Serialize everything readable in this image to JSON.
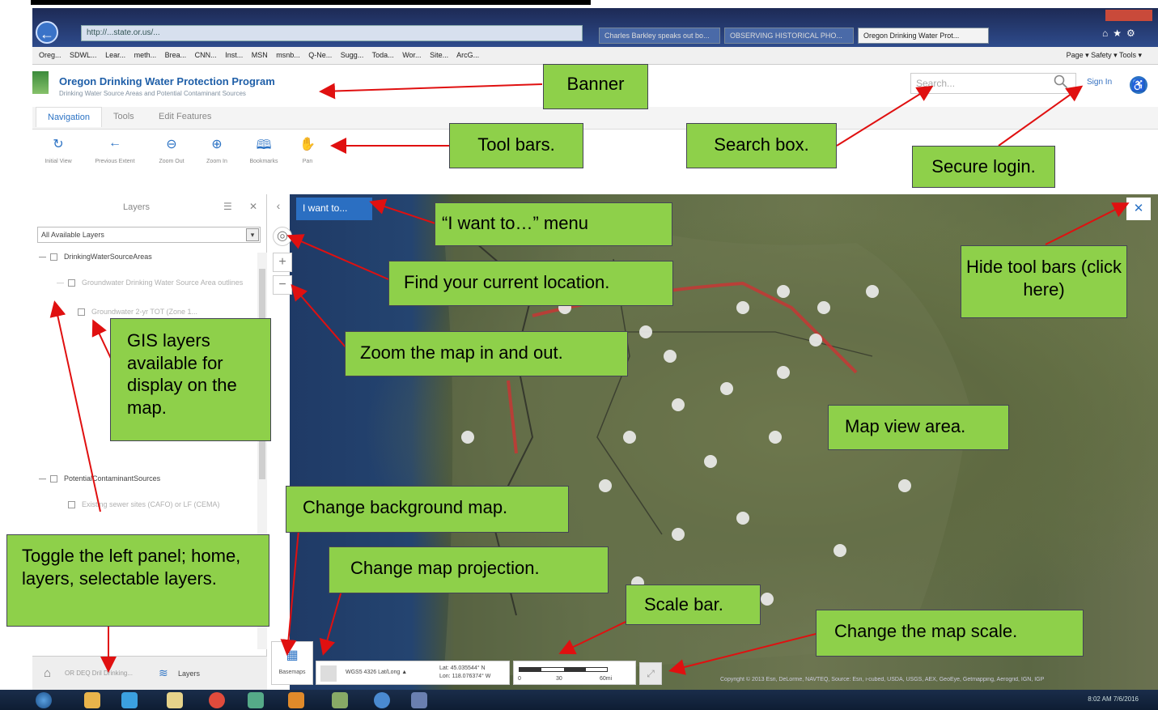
{
  "browser": {
    "address": "http://...state.or.us/...",
    "tabs": [
      "Charles Barkley speaks out bo...",
      "OBSERVING HISTORICAL PHO...",
      "Oregon Drinking Water Prot..."
    ],
    "favorites": [
      "Oreg...",
      "SDWL...",
      "Lear...",
      "meth...",
      "Brea...",
      "CNN...",
      "Inst...",
      "MSN",
      "msnb...",
      "Q-Ne...",
      "Sugg...",
      "Toda...",
      "Wor...",
      "Site...",
      "ArcG..."
    ],
    "command_bar": "Page ▾   Safety ▾   Tools ▾"
  },
  "app": {
    "title": "Oregon Drinking Water Protection Program",
    "subtitle": "Drinking Water Source Areas and Potential Contaminant Sources",
    "search_placeholder": "Search...",
    "sign_in": "Sign In",
    "tabs": [
      "Navigation",
      "Tools",
      "Edit Features"
    ],
    "toolbar": [
      {
        "label": "Initial View",
        "icon": "refresh-icon"
      },
      {
        "label": "Previous Extent",
        "icon": "back-arrow-icon"
      },
      {
        "label": "Zoom Out",
        "icon": "minus-icon"
      },
      {
        "label": "Zoom In",
        "icon": "plus-icon"
      },
      {
        "label": "Bookmarks",
        "icon": "book-icon"
      },
      {
        "label": "Pan",
        "icon": "hand-icon"
      }
    ]
  },
  "left_panel": {
    "title": "Layers",
    "filter": "All Available Layers",
    "layers": [
      {
        "label": "DrinkingWaterSourceAreas",
        "dim": false
      },
      {
        "label": "Groundwater Drinking Water Source Area outlines",
        "dim": true
      },
      {
        "label": "Groundwater 2-yr TOT (Zone 1...",
        "dim": true
      },
      {
        "label": "PotentialContaminantSources",
        "dim": false
      },
      {
        "label": "Existing sewer sites (CAFO) or LF (CEMA)",
        "dim": true
      }
    ],
    "footer_home": "OR DEQ Dril Drinking...",
    "footer_layers": "Layers"
  },
  "map": {
    "i_want_to": "I want to...",
    "basemaps": "Basemaps",
    "wkid": "WGS5 4326 Lat/Long ▲",
    "lat": "Lat:  45.035544° N",
    "lon": "Lon: 118.076374° W",
    "scale_labels": [
      "0",
      "30",
      "60mi"
    ],
    "attribution": "Copyright © 2013 Esri, DeLorme, NAVTEQ, Source: Esri, i-cubed, USDA, USGS, AEX, GeoEye, Getmapping, Aerogrid, IGN, IGP"
  },
  "taskbar": {
    "clock": "8:02 AM\n7/6/2016"
  },
  "callouts": {
    "banner": "Banner",
    "toolbars": "Tool bars.",
    "search": "Search box.",
    "login": "Secure login.",
    "iwant": "“I want to…” menu",
    "location": "Find your current location.",
    "hide": "Hide tool bars (click here)",
    "gis": "GIS layers available for display on the map.",
    "zoom": "Zoom the map in and out.",
    "mapview": "Map view area.",
    "background": "Change background map.",
    "toggle": "Toggle the left panel; home, layers, selectable layers.",
    "projection": "Change map projection.",
    "scalebar": "Scale bar.",
    "mapscale": "Change the map scale."
  },
  "colors": {
    "callout": "#8ed04a",
    "accent": "#2b72c4",
    "arrow": "#e01010"
  }
}
